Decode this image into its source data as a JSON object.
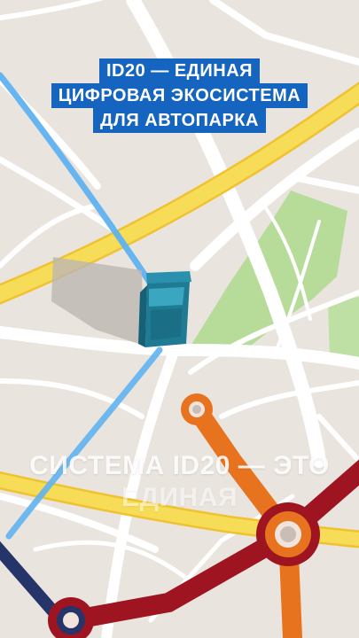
{
  "title": {
    "lines": [
      "ID20 — ЕДИНАЯ",
      "ЦИФРОВАЯ ЭКОСИСТЕМА",
      "ДЛЯ АВТОПАРКА"
    ]
  },
  "caption": {
    "line1": "СИСТЕМА ID20 — ЭТО",
    "line2": "ЕДИНАЯ"
  },
  "colors": {
    "accent": "#1565c0",
    "map_background": "#e9e4de",
    "road": "#ffffff",
    "highway": "#f5d94a",
    "park": "#b7dc9a",
    "route": "#5fb2f0",
    "vehicle": "#1f7a94",
    "metro_orange": "#e8731f",
    "metro_red": "#9e1420",
    "metro_navy": "#263569"
  },
  "icons": {
    "vehicle": "van-3d-icon",
    "stations": "metro-station-icon"
  }
}
